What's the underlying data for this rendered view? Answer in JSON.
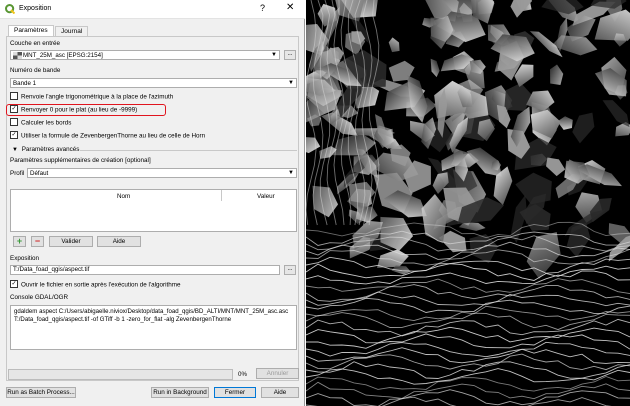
{
  "window": {
    "title": "Exposition",
    "help": "?",
    "close": "✕"
  },
  "tabs": [
    "Paramètres",
    "Journal"
  ],
  "params": {
    "input_layer_label": "Couche en entrée",
    "input_layer_value": "MNT_25M_asc [EPSG:2154]",
    "band_label": "Numéro de bande",
    "band_value": "Bande 1",
    "chk_trig": "Renvoie l'angle trigonométrique à la place de l'azimuth",
    "chk_zero": "Renvoyer 0 pour le plat (au lieu de -9999)",
    "chk_edges": "Calculer les bords",
    "chk_zeven": "Utiliser la formule de ZevenbergenThorne au lieu de celle de Horn",
    "advanced": "Paramètres avancés",
    "creation_label": "Paramètres supplémentaires de création [optional]",
    "profile_label": "Profil",
    "profile_value": "Défaut",
    "col_name": "Nom",
    "col_value": "Valeur",
    "validate": "Valider",
    "help": "Aide",
    "output_label": "Exposition",
    "output_value": "T:/Data_foad_qgis/aspect.tif",
    "open_after": "Ouvrir le fichier en sortie après l'exécution de l'algorithme",
    "console_label": "Console GDAL/OGR",
    "console_text": "gdaldem aspect C:/Users/abigaelle.niviox/Desktop/data_foad_qgis/BD_ALTI/MNT/MNT_25M_asc.asc T:/Data_foad_qgis/aspect.tif -of GTiff -b 1 -zero_for_flat -alg ZevenbergenThorne",
    "dots": "..."
  },
  "footer": {
    "progress_pct": "0%",
    "cancel": "Annuler",
    "batch": "Run as Batch Process...",
    "background": "Run in Background",
    "close": "Fermer",
    "help": "Aide"
  },
  "checks": {
    "trig": false,
    "zero": true,
    "edges": false,
    "zeven": true,
    "open_after": true
  },
  "colors": {
    "highlight": "#e0141e",
    "qgis_green": "#589632",
    "qgis_yellow": "#f0c419"
  },
  "progress": 0
}
